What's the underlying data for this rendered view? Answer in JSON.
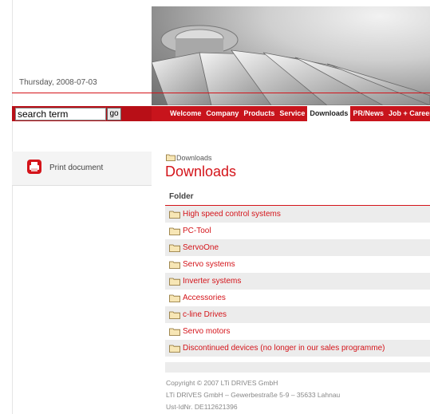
{
  "header": {
    "date": "Thursday, 2008-07-03"
  },
  "search": {
    "value": "search term",
    "go_label": "go"
  },
  "nav": {
    "items": [
      {
        "label": "Welcome",
        "active": false
      },
      {
        "label": "Company",
        "active": false
      },
      {
        "label": "Products",
        "active": false
      },
      {
        "label": "Service",
        "active": false
      },
      {
        "label": "Downloads",
        "active": true
      },
      {
        "label": "PR/News",
        "active": false
      },
      {
        "label": "Job + Career",
        "active": false
      }
    ]
  },
  "sidebar": {
    "print_label": "Print document",
    "print_icon": "printer-icon"
  },
  "content": {
    "breadcrumb": "Downloads",
    "title": "Downloads",
    "folder_header": "Folder",
    "folders": [
      "High speed control systems",
      "PC-Tool",
      "ServoOne",
      "Servo systems",
      "Inverter systems",
      "Accessories",
      "c-line Drives",
      "Servo motors",
      "Discontinued devices (no longer in our sales programme)"
    ]
  },
  "footer": {
    "line1": "Copyright © 2007 LTi DRIVES GmbH",
    "line2": "LTi DRIVES GmbH – Gewerbestraße 5-9 – 35633 Lahnau",
    "line3": "Ust-IdNr. DE112621396"
  },
  "colors": {
    "accent": "#d4141a",
    "nav_bg": "#c8141c",
    "row_shade": "#ececec"
  }
}
